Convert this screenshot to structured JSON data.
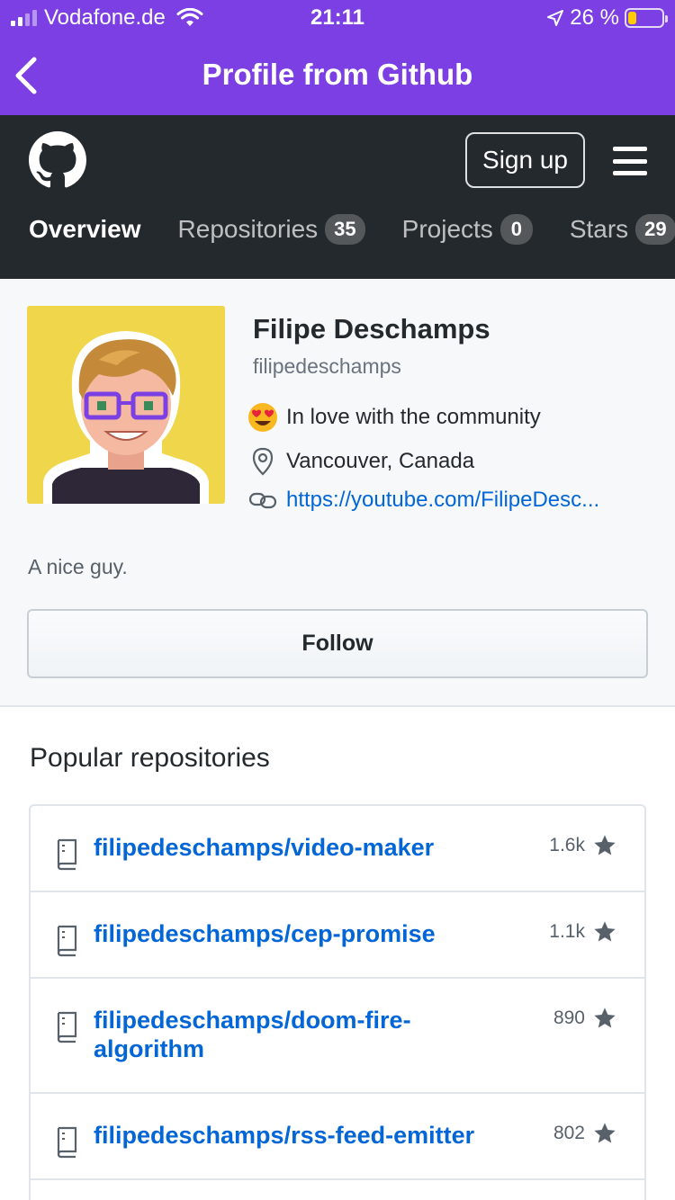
{
  "status_bar": {
    "carrier": "Vodafone.de",
    "time": "21:11",
    "battery": "26 %",
    "battery_level": 0.26
  },
  "app_bar": {
    "title": "Profile from Github"
  },
  "github_header": {
    "signup_label": "Sign up",
    "tabs": [
      {
        "label": "Overview",
        "count": ""
      },
      {
        "label": "Repositories",
        "count": "35"
      },
      {
        "label": "Projects",
        "count": "0"
      },
      {
        "label": "Stars",
        "count": "29"
      }
    ]
  },
  "profile": {
    "name": "Filipe Deschamps",
    "login": "filipedeschamps",
    "status": "In love with the community",
    "status_emoji": "heart-eyes-emoji",
    "location": "Vancouver, Canada",
    "website": "https://youtube.com/FilipeDesc...",
    "bio": "A nice guy.",
    "follow_label": "Follow"
  },
  "popular": {
    "title": "Popular repositories",
    "repos": [
      {
        "name": "filipedeschamps/video-maker",
        "stars": "1.6k"
      },
      {
        "name": "filipedeschamps/cep-promise",
        "stars": "1.1k"
      },
      {
        "name": "filipedeschamps/doom-fire-algorithm",
        "stars": "890"
      },
      {
        "name": "filipedeschamps/rss-feed-emitter",
        "stars": "802"
      }
    ]
  },
  "colors": {
    "app_bar": "#7b3fe4",
    "github_header": "#24292e",
    "link": "#0366d6",
    "avatar_bg": "#f0d64a"
  }
}
